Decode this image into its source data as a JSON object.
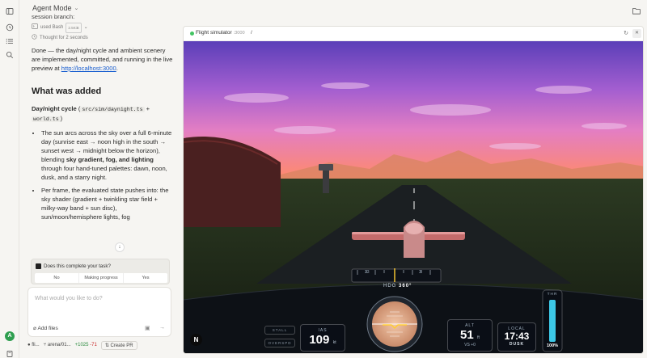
{
  "topbar": {
    "mode_label": "Agent Mode"
  },
  "chat": {
    "intro_text": "Everything's in. I'll add and commit the work to the session branch:",
    "tool_label": "used Bash",
    "tool_badge": "2.5KiB",
    "thought_label": "Thought for 2 seconds",
    "done_text_1": "Done — the day/night cycle and ambient scenery are implemented, committed, and running in the live preview at",
    "done_link": "http://localhost:3000",
    "done_text_2": ".",
    "heading": "What was added",
    "section_label": "Day/night cycle",
    "section_code_1": "src/sim/daynight.ts",
    "section_plus": "+",
    "section_code_2": "world.ts",
    "bullet_1_a": "The sun arcs across the sky over a full 6-minute day (sunrise east → noon high in the south → sunset west → midnight below the horizon), blending",
    "bullet_1_bold": "sky gradient, fog, and lighting",
    "bullet_1_b": "through four hand-tuned palettes: dawn, noon, dusk, and a starry night.",
    "bullet_2": "Per frame, the evaluated state pushes into: the sky shader (gradient + twinkling star field + milky-way band + sun disc), sun/moon/hemisphere lights, fog"
  },
  "confirm": {
    "question": "Does this complete your task?",
    "options": [
      "No",
      "Making progress",
      "Yes"
    ]
  },
  "composer": {
    "placeholder": "What would you like to do?",
    "add_files": "Add files"
  },
  "bottombar": {
    "repo": "fli...",
    "branch": "arena/01...",
    "additions": "+1025",
    "deletions": "-71",
    "create_pr": "Create PR"
  },
  "preview": {
    "app_name": "Flight simulator",
    "port": ":3000",
    "path": "/"
  },
  "hud": {
    "heading_label": "HDG",
    "heading_value": "360°",
    "tape_left": "33",
    "tape_right": "3",
    "stall": "STALL",
    "gear": "OVERSPD",
    "ias_label": "IAS",
    "ias_value": "109",
    "ias_unit": "kt",
    "alt_label": "ALT",
    "alt_value": "51",
    "alt_unit": "ft",
    "vs_label": "VS +0",
    "local_label": "LOCAL",
    "local_time": "17:43",
    "local_phase": "DUSK",
    "thr_label": "THR",
    "thr_value": "100%",
    "throttle_fraction": 1.0
  },
  "colors": {
    "sky_top": "#5b3fb8",
    "sky_mid": "#c96fd0",
    "horizon": "#ff8a6b",
    "ground": "#1f2a18",
    "throttle": "#3cc7e6"
  }
}
